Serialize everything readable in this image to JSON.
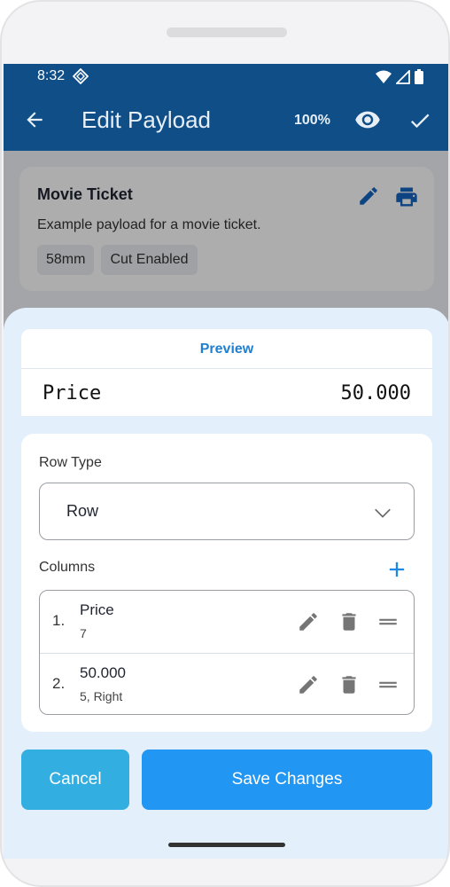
{
  "status": {
    "time": "8:32"
  },
  "appbar": {
    "title": "Edit Payload",
    "zoom": "100%"
  },
  "ticket": {
    "name": "Movie Ticket",
    "description": "Example payload for a movie ticket.",
    "chips": [
      "58mm",
      "Cut Enabled"
    ]
  },
  "preview": {
    "label": "Preview",
    "left": "Price",
    "right": "50.000"
  },
  "form": {
    "row_type_label": "Row Type",
    "row_type_value": "Row",
    "columns_label": "Columns",
    "columns": [
      {
        "index": "1.",
        "title": "Price",
        "subtitle": "7"
      },
      {
        "index": "2.",
        "title": "50.000",
        "subtitle": "5, Right"
      }
    ]
  },
  "actions": {
    "cancel": "Cancel",
    "save": "Save Changes"
  },
  "colors": {
    "appbar": "#0f4e87",
    "accent": "#2196f3",
    "cancel": "#33aee0",
    "sheet": "#e3f0fc",
    "icon_blue": "#1565c0",
    "icon_gray": "#757575"
  }
}
